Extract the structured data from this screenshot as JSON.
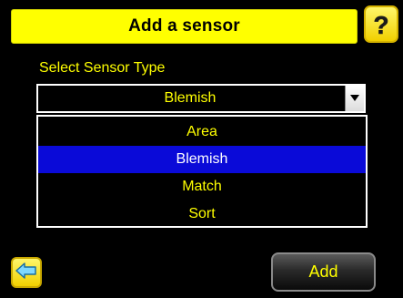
{
  "header": {
    "title": "Add a sensor",
    "help_icon": "help-icon",
    "help_glyph": "?"
  },
  "sensor_type": {
    "label": "Select Sensor Type",
    "selected_value": "Blemish",
    "dropdown_icon": "chevron-down-icon"
  },
  "dropdown": {
    "items": [
      {
        "label": "Area",
        "selected": false
      },
      {
        "label": "Blemish",
        "selected": true
      },
      {
        "label": "Match",
        "selected": false
      },
      {
        "label": "Sort",
        "selected": false
      }
    ]
  },
  "footer": {
    "back_icon": "back-arrow-icon",
    "add_label": "Add"
  },
  "colors": {
    "background": "#000000",
    "accent_yellow": "#ffff00",
    "selection_blue": "#0a0ad8",
    "text_dark": "#000000",
    "text_light": "#ffffff"
  }
}
